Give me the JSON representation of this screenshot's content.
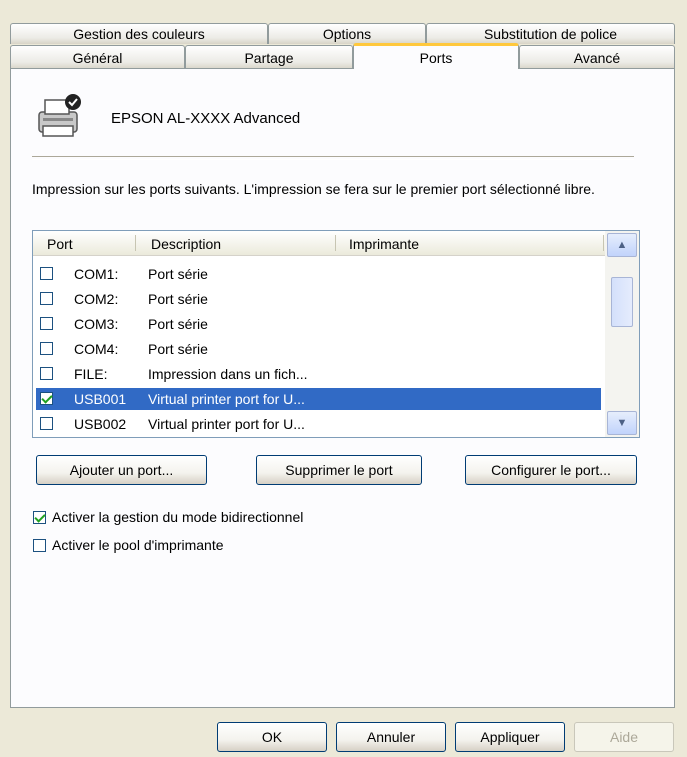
{
  "tabs_back": [
    "Gestion des couleurs",
    "Options",
    "Substitution de police"
  ],
  "tabs_front": [
    "Général",
    "Partage",
    "Ports",
    "Avancé"
  ],
  "printer_name": "EPSON AL-XXXX Advanced",
  "instructions": "Impression sur les ports suivants. L'impression se fera sur le premier port sélectionné libre.",
  "columns": [
    "Port",
    "Description",
    "Imprimante"
  ],
  "ports": [
    {
      "port": "COM1:",
      "description": "Port série",
      "checked": false,
      "selected": false
    },
    {
      "port": "COM2:",
      "description": "Port série",
      "checked": false,
      "selected": false
    },
    {
      "port": "COM3:",
      "description": "Port série",
      "checked": false,
      "selected": false
    },
    {
      "port": "COM4:",
      "description": "Port série",
      "checked": false,
      "selected": false
    },
    {
      "port": "FILE:",
      "description": "Impression dans un fich...",
      "checked": false,
      "selected": false
    },
    {
      "port": "USB001",
      "description": "Virtual printer port for U...",
      "checked": true,
      "selected": true
    },
    {
      "port": "USB002",
      "description": "Virtual printer port for U...",
      "checked": false,
      "selected": false
    }
  ],
  "buttons": {
    "add_port": "Ajouter un port...",
    "delete_port": "Supprimer le port",
    "configure_port": "Configurer le port..."
  },
  "options": {
    "bidirectional": {
      "label": "Activer la gestion du mode bidirectionnel",
      "checked": true
    },
    "pool": {
      "label": "Activer le pool d'imprimante",
      "checked": false
    }
  },
  "dialog_buttons": {
    "ok": "OK",
    "cancel": "Annuler",
    "apply": "Appliquer",
    "help": "Aide"
  }
}
